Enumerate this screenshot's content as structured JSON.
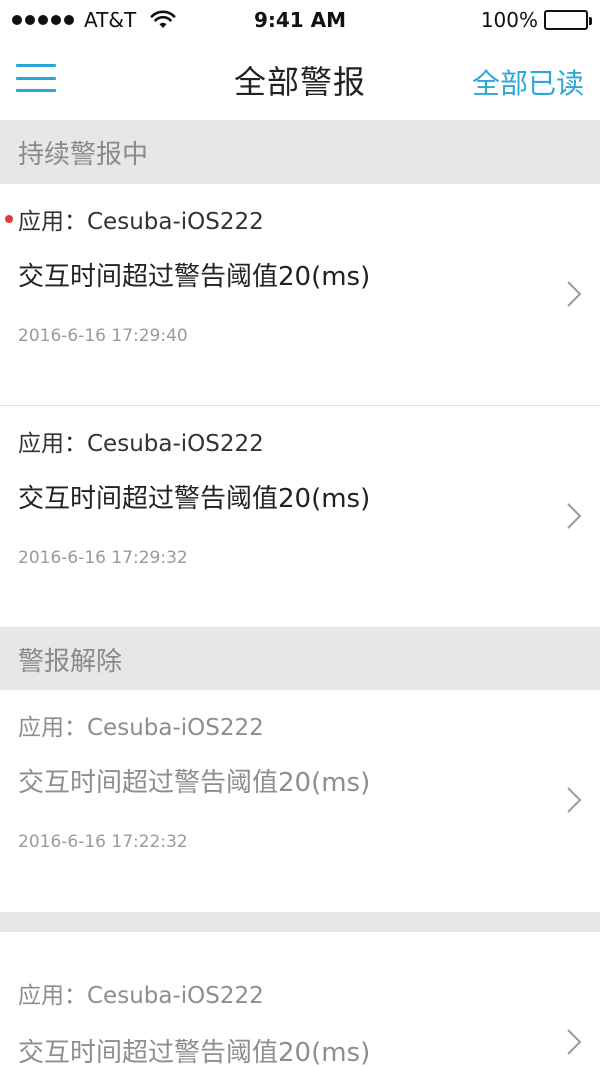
{
  "status_bar": {
    "carrier": "AT&T",
    "time": "9:41 AM",
    "battery_text": "100%",
    "battery_level": 1.0
  },
  "nav": {
    "title": "全部警报",
    "mark_all_read": "全部已读"
  },
  "sections": [
    {
      "title": "持续警报中",
      "items": [
        {
          "app": "应用：Cesuba-iOS222",
          "message": "交互时间超过警告阈值20(ms)",
          "time": "2016-6-16 17:29:40",
          "unread": true
        },
        {
          "app": "应用：Cesuba-iOS222",
          "message": "交互时间超过警告阈值20(ms)",
          "time": "2016-6-16 17:29:32",
          "unread": false
        }
      ]
    },
    {
      "title": "警报解除",
      "items": [
        {
          "app": "应用：Cesuba-iOS222",
          "message": "交互时间超过警告阈值20(ms)",
          "time": "2016-6-16 17:22:32",
          "unread": false
        },
        {
          "app": "应用：Cesuba-iOS222",
          "message": "交互时间超过警告阈值20(ms)",
          "time": "",
          "unread": false
        }
      ]
    }
  ],
  "colors": {
    "accent": "#2ca7d9",
    "unread_dot": "#e23a3a",
    "section_bg": "#e7e7e9"
  },
  "icons": {
    "menu": "hamburger-icon",
    "row_arrow": "chevron-right-icon",
    "wifi": "wifi-icon",
    "battery": "battery-icon"
  }
}
